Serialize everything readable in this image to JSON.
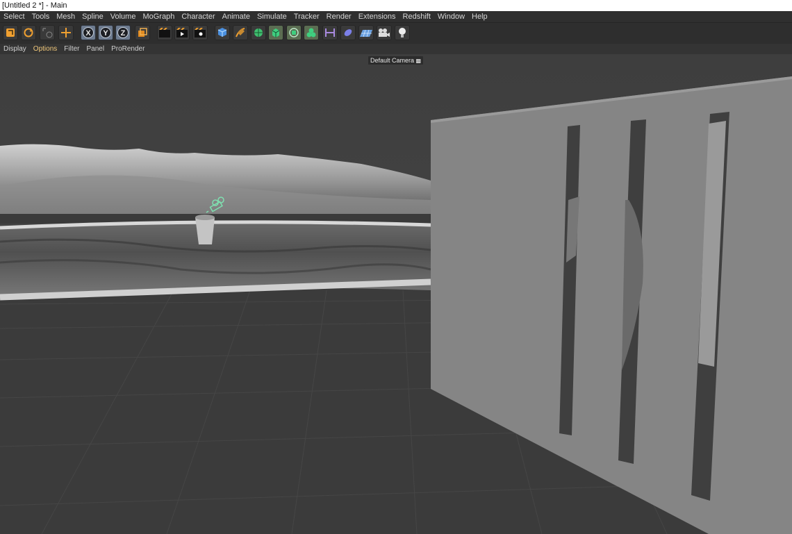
{
  "window": {
    "title": "[Untitled 2 *] - Main"
  },
  "menubar": {
    "items": [
      "Select",
      "Tools",
      "Mesh",
      "Spline",
      "Volume",
      "MoGraph",
      "Character",
      "Animate",
      "Simulate",
      "Tracker",
      "Render",
      "Extensions",
      "Redshift",
      "Window",
      "Help"
    ]
  },
  "toolbar": {
    "axes": [
      "X",
      "Y",
      "Z"
    ],
    "icons": {
      "undo": "undo-icon",
      "redo": "redo-icon",
      "live_selection": "live-selection-icon",
      "move": "move-icon",
      "coordinate_system": "coordinate-system-icon",
      "render_view": "render-view-icon",
      "render_picture": "render-picture-icon",
      "render_settings": "render-settings-icon",
      "cube": "cube-icon",
      "pen": "pen-icon",
      "subdivision": "subdivision-icon",
      "extrude": "extrude-icon",
      "array": "array-icon",
      "cloner": "cloner-icon",
      "deformer": "deformer-icon",
      "field": "field-icon",
      "floor": "floor-icon",
      "camera": "camera-icon",
      "light": "light-icon"
    }
  },
  "viewport_menu": {
    "items": [
      "Display",
      "Options",
      "Filter",
      "Panel",
      "ProRender"
    ],
    "active": "Options"
  },
  "viewport": {
    "camera_label": "Default Camera",
    "camera_icon": "camera-small-icon"
  },
  "colors": {
    "background": "#3c3c3c",
    "menubar": "#2f2f2f",
    "toolbar": "#2e2e2e",
    "accent_orange": "#f0a030",
    "accent_green": "#7fe0b0",
    "axis_button": "#6d7b8f"
  }
}
